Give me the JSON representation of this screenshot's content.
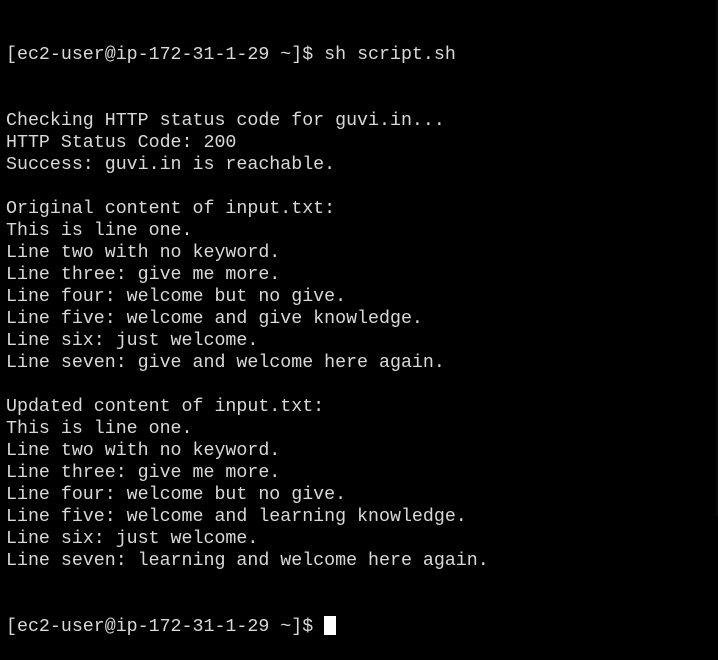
{
  "terminal": {
    "prompt": "[ec2-user@ip-172-31-1-29 ~]$ ",
    "command": "sh script.sh",
    "output": [
      "Checking HTTP status code for guvi.in...",
      "HTTP Status Code: 200",
      "Success: guvi.in is reachable.",
      "",
      "Original content of input.txt:",
      "This is line one.",
      "Line two with no keyword.",
      "Line three: give me more.",
      "Line four: welcome but no give.",
      "Line five: welcome and give knowledge.",
      "Line six: just welcome.",
      "Line seven: give and welcome here again.",
      "",
      "Updated content of input.txt:",
      "This is line one.",
      "Line two with no keyword.",
      "Line three: give me more.",
      "Line four: welcome but no give.",
      "Line five: welcome and learning knowledge.",
      "Line six: just welcome.",
      "Line seven: learning and welcome here again."
    ],
    "final_prompt": "[ec2-user@ip-172-31-1-29 ~]$ ",
    "colors": {
      "background": "#000000",
      "foreground": "#d9d9d9",
      "cursor": "#ffffff"
    }
  }
}
